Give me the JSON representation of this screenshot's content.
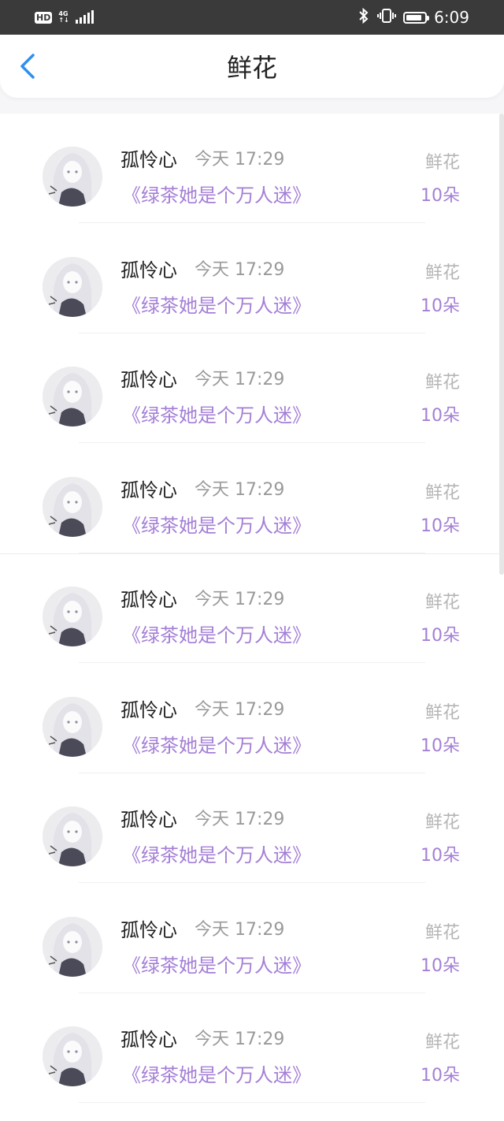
{
  "status_bar": {
    "hd": "HD",
    "network_top": "4G",
    "network_bottom": "↑↓",
    "bluetooth_icon": "bluetooth-icon",
    "vibrate_icon": "vibrate-icon",
    "battery_level": 0.85,
    "time": "6:09"
  },
  "header": {
    "back_icon": "chevron-left-icon",
    "title": "鲜花"
  },
  "list": {
    "items": [
      {
        "name": "孤怜心",
        "time": "今天 17:29",
        "book": "《绿茶她是个万人迷》",
        "gift": "鲜花",
        "count": "10朵"
      },
      {
        "name": "孤怜心",
        "time": "今天 17:29",
        "book": "《绿茶她是个万人迷》",
        "gift": "鲜花",
        "count": "10朵"
      },
      {
        "name": "孤怜心",
        "time": "今天 17:29",
        "book": "《绿茶她是个万人迷》",
        "gift": "鲜花",
        "count": "10朵"
      },
      {
        "name": "孤怜心",
        "time": "今天 17:29",
        "book": "《绿茶她是个万人迷》",
        "gift": "鲜花",
        "count": "10朵"
      },
      {
        "name": "孤怜心",
        "time": "今天 17:29",
        "book": "《绿茶她是个万人迷》",
        "gift": "鲜花",
        "count": "10朵"
      },
      {
        "name": "孤怜心",
        "time": "今天 17:29",
        "book": "《绿茶她是个万人迷》",
        "gift": "鲜花",
        "count": "10朵"
      },
      {
        "name": "孤怜心",
        "time": "今天 17:29",
        "book": "《绿茶她是个万人迷》",
        "gift": "鲜花",
        "count": "10朵"
      },
      {
        "name": "孤怜心",
        "time": "今天 17:29",
        "book": "《绿茶她是个万人迷》",
        "gift": "鲜花",
        "count": "10朵"
      },
      {
        "name": "孤怜心",
        "time": "今天 17:29",
        "book": "《绿茶她是个万人迷》",
        "gift": "鲜花",
        "count": "10朵"
      }
    ]
  },
  "colors": {
    "accent_purple": "#a47fd6",
    "back_blue": "#2e8ff0",
    "status_bar_bg": "#3a3a3a"
  }
}
